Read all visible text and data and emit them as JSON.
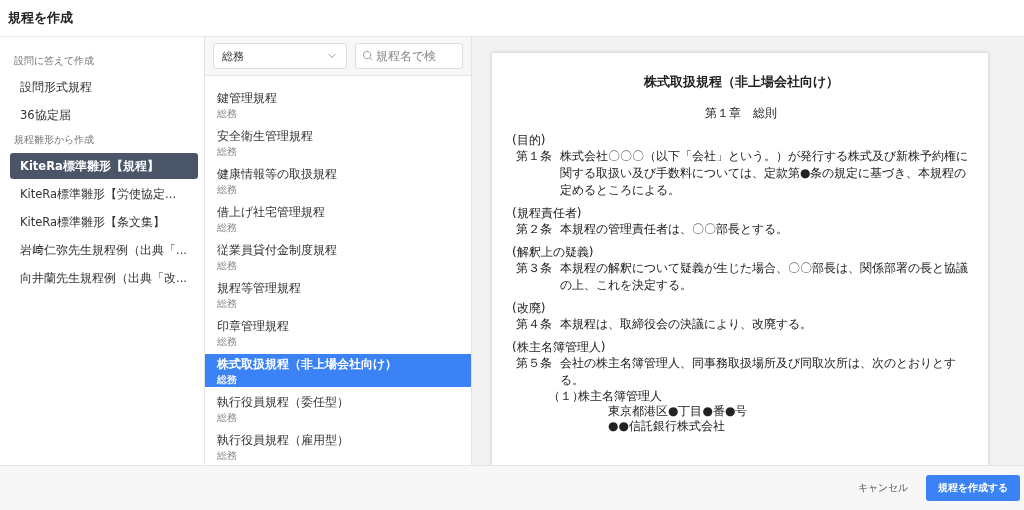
{
  "window": {
    "title": "規程を作成"
  },
  "sidebar": {
    "groups": [
      {
        "heading": "設問に答えて作成",
        "items": [
          {
            "label": "設問形式規程",
            "selected": false
          },
          {
            "label": "36協定届",
            "selected": false
          }
        ]
      },
      {
        "heading": "規程雛形から作成",
        "items": [
          {
            "label": "KiteRa標準雛形【規程】",
            "selected": true
          },
          {
            "label": "KiteRa標準雛形【労使協定...",
            "selected": false
          },
          {
            "label": "KiteRa標準雛形【条文集】",
            "selected": false
          },
          {
            "label": "岩﨑仁弥先生規程例（出典「...",
            "selected": false
          },
          {
            "label": "向井蘭先生規程例（出典「改...",
            "selected": false
          }
        ]
      }
    ]
  },
  "filter": {
    "category": "総務",
    "search_placeholder": "規程名で検"
  },
  "templates": [
    {
      "name": "鍵管理規程",
      "category": "総務",
      "selected": false
    },
    {
      "name": "安全衛生管理規程",
      "category": "総務",
      "selected": false
    },
    {
      "name": "健康情報等の取扱規程",
      "category": "総務",
      "selected": false
    },
    {
      "name": "借上げ社宅管理規程",
      "category": "総務",
      "selected": false
    },
    {
      "name": "従業員貸付金制度規程",
      "category": "総務",
      "selected": false
    },
    {
      "name": "規程等管理規程",
      "category": "総務",
      "selected": false
    },
    {
      "name": "印章管理規程",
      "category": "総務",
      "selected": false
    },
    {
      "name": "株式取扱規程（非上場会社向け）",
      "category": "総務",
      "selected": true
    },
    {
      "name": "執行役員規程（委任型）",
      "category": "総務",
      "selected": false
    },
    {
      "name": "執行役員規程（雇用型）",
      "category": "総務",
      "selected": false
    }
  ],
  "document": {
    "title": "株式取扱規程（非上場会社向け）",
    "chapter": "第１章　総則",
    "blocks": [
      {
        "kind": "caption",
        "text": "(目的)"
      },
      {
        "kind": "article",
        "number": "第１条",
        "text": "株式会社〇〇〇（以下「会社」という。）が発行する株式及び新株予約権に関する取扱い及び手数料については、定款第●条の規定に基づき、本規程の定めるところによる。"
      },
      {
        "kind": "caption",
        "text": "(規程責任者)"
      },
      {
        "kind": "article",
        "number": "第２条",
        "text": "本規程の管理責任者は、〇〇部長とする。"
      },
      {
        "kind": "caption",
        "text": "(解釈上の疑義)"
      },
      {
        "kind": "article",
        "number": "第３条",
        "text": "本規程の解釈について疑義が生じた場合、〇〇部長は、関係部署の長と協議の上、これを決定する。"
      },
      {
        "kind": "caption",
        "text": "(改廃)"
      },
      {
        "kind": "article",
        "number": "第４条",
        "text": "本規程は、取締役会の決議により、改廃する。"
      },
      {
        "kind": "caption",
        "text": "(株主名簿管理人)"
      },
      {
        "kind": "article",
        "number": "第５条",
        "text": "会社の株主名簿管理人、同事務取扱場所及び同取次所は、次のとおりとする。"
      },
      {
        "kind": "item",
        "number": "（１）",
        "text": "株主名簿管理人"
      },
      {
        "kind": "detail",
        "text": "東京都港区●丁目●番●号"
      },
      {
        "kind": "detail",
        "text": "●●信託銀行株式会社"
      }
    ]
  },
  "footer": {
    "cancel": "キャンセル",
    "submit": "規程を作成する"
  }
}
